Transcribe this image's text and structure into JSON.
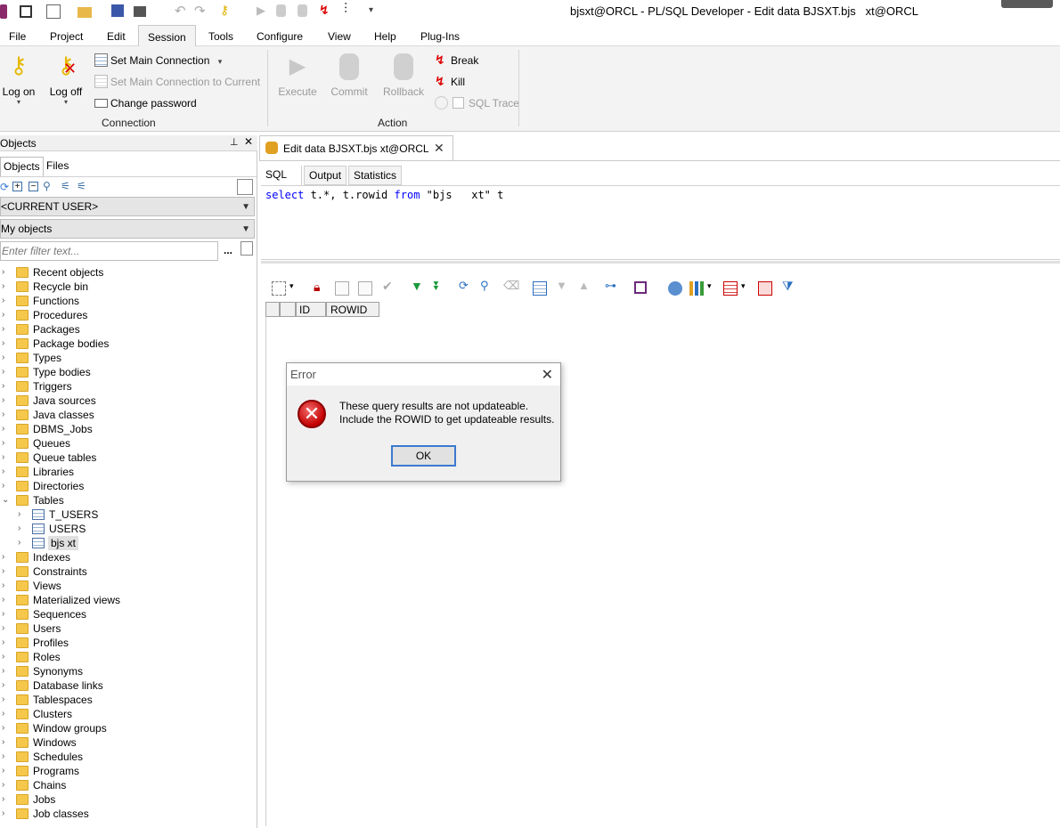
{
  "window": {
    "title": "bjsxt@ORCL - PL/SQL Developer - Edit data BJSXT.bjs   xt@ORCL"
  },
  "menu": [
    "File",
    "Project",
    "Edit",
    "Session",
    "Tools",
    "Configure",
    "View",
    "Help",
    "Plug-Ins"
  ],
  "menu_active": "Session",
  "ribbon": {
    "logon": "Log on",
    "logoff": "Log off",
    "set_main": "Set Main Connection",
    "set_main_current": "Set Main Connection to Current",
    "change_password": "Change password",
    "connection_group": "Connection",
    "execute": "Execute",
    "commit": "Commit",
    "rollback": "Rollback",
    "break": "Break",
    "kill": "Kill",
    "sql_trace": "SQL Trace",
    "action_group": "Action"
  },
  "left_panel": {
    "header": "Objects",
    "tabs": [
      "Objects",
      "Files"
    ],
    "user_combo": "<CURRENT USER>",
    "objects_combo": "My objects",
    "filter_placeholder": "Enter filter text...",
    "more_btn": "...",
    "tree": [
      "Recent objects",
      "Recycle bin",
      "Functions",
      "Procedures",
      "Packages",
      "Package bodies",
      "Types",
      "Type bodies",
      "Triggers",
      "Java sources",
      "Java classes",
      "DBMS_Jobs",
      "Queues",
      "Queue tables",
      "Libraries",
      "Directories",
      "Tables"
    ],
    "tables": [
      "T_USERS",
      "USERS",
      "bjs   xt"
    ],
    "tree_after": [
      "Indexes",
      "Constraints",
      "Views",
      "Materialized views",
      "Sequences",
      "Users",
      "Profiles",
      "Roles",
      "Synonyms",
      "Database links",
      "Tablespaces",
      "Clusters",
      "Window groups",
      "Windows",
      "Schedules",
      "Programs",
      "Chains",
      "Jobs",
      "Job classes"
    ]
  },
  "editor": {
    "doc_tab": "Edit data BJSXT.bjs   xt@ORCL",
    "sub_tabs": [
      "SQL",
      "Output",
      "Statistics"
    ],
    "sql_select": "select",
    "sql_mid": " t.*, t.rowid ",
    "sql_from": "from",
    "sql_rest": " \"bjs   xt\" t",
    "columns": [
      "ID",
      "ROWID"
    ]
  },
  "dialog": {
    "title": "Error",
    "line1": "These query results are not updateable.",
    "line2": "Include the ROWID to get updateable results.",
    "ok": "OK"
  }
}
